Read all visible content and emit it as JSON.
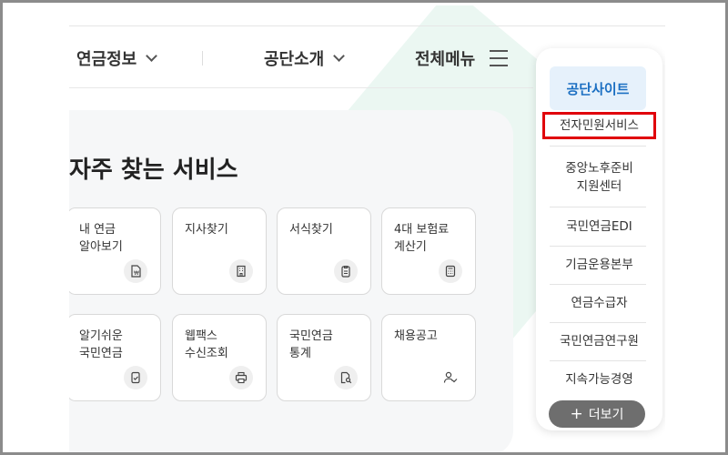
{
  "nav": {
    "pension_info": "연금정보",
    "nps_intro": "공단소개",
    "full_menu": "전체메뉴"
  },
  "services": {
    "title": "자주 찾는 서비스",
    "tiles": [
      {
        "label": "내 연금\n알아보기",
        "icon": "pension-doc-icon"
      },
      {
        "label": "지사찾기",
        "icon": "building-icon"
      },
      {
        "label": "서식찾기",
        "icon": "clipboard-icon"
      },
      {
        "label": "4대 보험료\n계산기",
        "icon": "calculator-icon"
      },
      {
        "label": "알기쉬운\n국민연금",
        "icon": "doc-check-icon"
      },
      {
        "label": "웹팩스\n수신조회",
        "icon": "printer-icon"
      },
      {
        "label": "국민연금\n통계",
        "icon": "doc-search-icon"
      },
      {
        "label": "채용공고",
        "icon": "user-check-icon"
      }
    ]
  },
  "sidebar": {
    "heading": "공단사이트",
    "items": [
      "전자민원서비스",
      "중앙노후준비\n지원센터",
      "국민연금EDI",
      "기금운용본부",
      "연금수급자",
      "국민연금연구원",
      "지속가능경영"
    ],
    "more_label": "더보기"
  },
  "colors": {
    "accent": "#1b6fc2",
    "highlight_border": "#e0000b",
    "more_button": "#6e6e6e"
  }
}
